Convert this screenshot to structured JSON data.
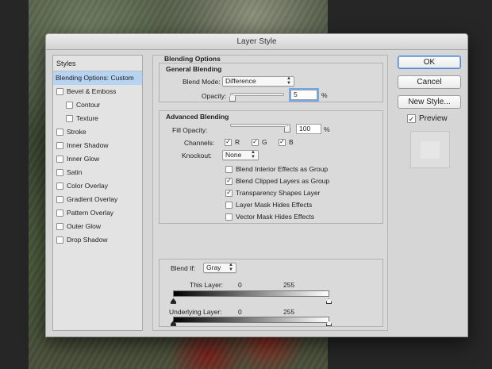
{
  "dialog": {
    "title": "Layer Style"
  },
  "styles_panel": {
    "header": "Styles",
    "items": [
      {
        "label": "Blending Options: Custom",
        "checkbox": false,
        "selected": true,
        "indent": 0
      },
      {
        "label": "Bevel & Emboss",
        "checkbox": true,
        "checked": false,
        "indent": 0
      },
      {
        "label": "Contour",
        "checkbox": true,
        "checked": false,
        "indent": 1
      },
      {
        "label": "Texture",
        "checkbox": true,
        "checked": false,
        "indent": 1
      },
      {
        "label": "Stroke",
        "checkbox": true,
        "checked": false,
        "indent": 0
      },
      {
        "label": "Inner Shadow",
        "checkbox": true,
        "checked": false,
        "indent": 0
      },
      {
        "label": "Inner Glow",
        "checkbox": true,
        "checked": false,
        "indent": 0
      },
      {
        "label": "Satin",
        "checkbox": true,
        "checked": false,
        "indent": 0
      },
      {
        "label": "Color Overlay",
        "checkbox": true,
        "checked": false,
        "indent": 0
      },
      {
        "label": "Gradient Overlay",
        "checkbox": true,
        "checked": false,
        "indent": 0
      },
      {
        "label": "Pattern Overlay",
        "checkbox": true,
        "checked": false,
        "indent": 0
      },
      {
        "label": "Outer Glow",
        "checkbox": true,
        "checked": false,
        "indent": 0
      },
      {
        "label": "Drop Shadow",
        "checkbox": true,
        "checked": false,
        "indent": 0
      }
    ]
  },
  "blending": {
    "title": "Blending Options",
    "general": {
      "title": "General Blending",
      "blend_mode_label": "Blend Mode:",
      "blend_mode_value": "Difference",
      "opacity_label": "Opacity:",
      "opacity_value": "5",
      "opacity_level": 5,
      "percent": "%"
    },
    "advanced": {
      "title": "Advanced Blending",
      "fill_opacity_label": "Fill Opacity:",
      "fill_opacity_value": "100",
      "fill_opacity_level": 100,
      "percent": "%",
      "channels_label": "Channels:",
      "channel_r": "R",
      "channel_g": "G",
      "channel_b": "B",
      "knockout_label": "Knockout:",
      "knockout_value": "None",
      "options": [
        {
          "label": "Blend Interior Effects as Group",
          "checked": false
        },
        {
          "label": "Blend Clipped Layers as Group",
          "checked": true
        },
        {
          "label": "Transparency Shapes Layer",
          "checked": true
        },
        {
          "label": "Layer Mask Hides Effects",
          "checked": false
        },
        {
          "label": "Vector Mask Hides Effects",
          "checked": false
        }
      ]
    },
    "blend_if": {
      "label": "Blend If:",
      "value": "Gray",
      "this_layer_label": "This Layer:",
      "this_min": "0",
      "this_max": "255",
      "underlying_label": "Underlying Layer:",
      "under_min": "0",
      "under_max": "255"
    }
  },
  "buttons": {
    "ok": "OK",
    "cancel": "Cancel",
    "new_style": "New Style..."
  },
  "preview": {
    "label": "Preview",
    "checked": true
  },
  "colors": {
    "selection": "#b6d3f2",
    "focus": "#78a8e3",
    "dialog_bg": "#d6d6d6"
  }
}
